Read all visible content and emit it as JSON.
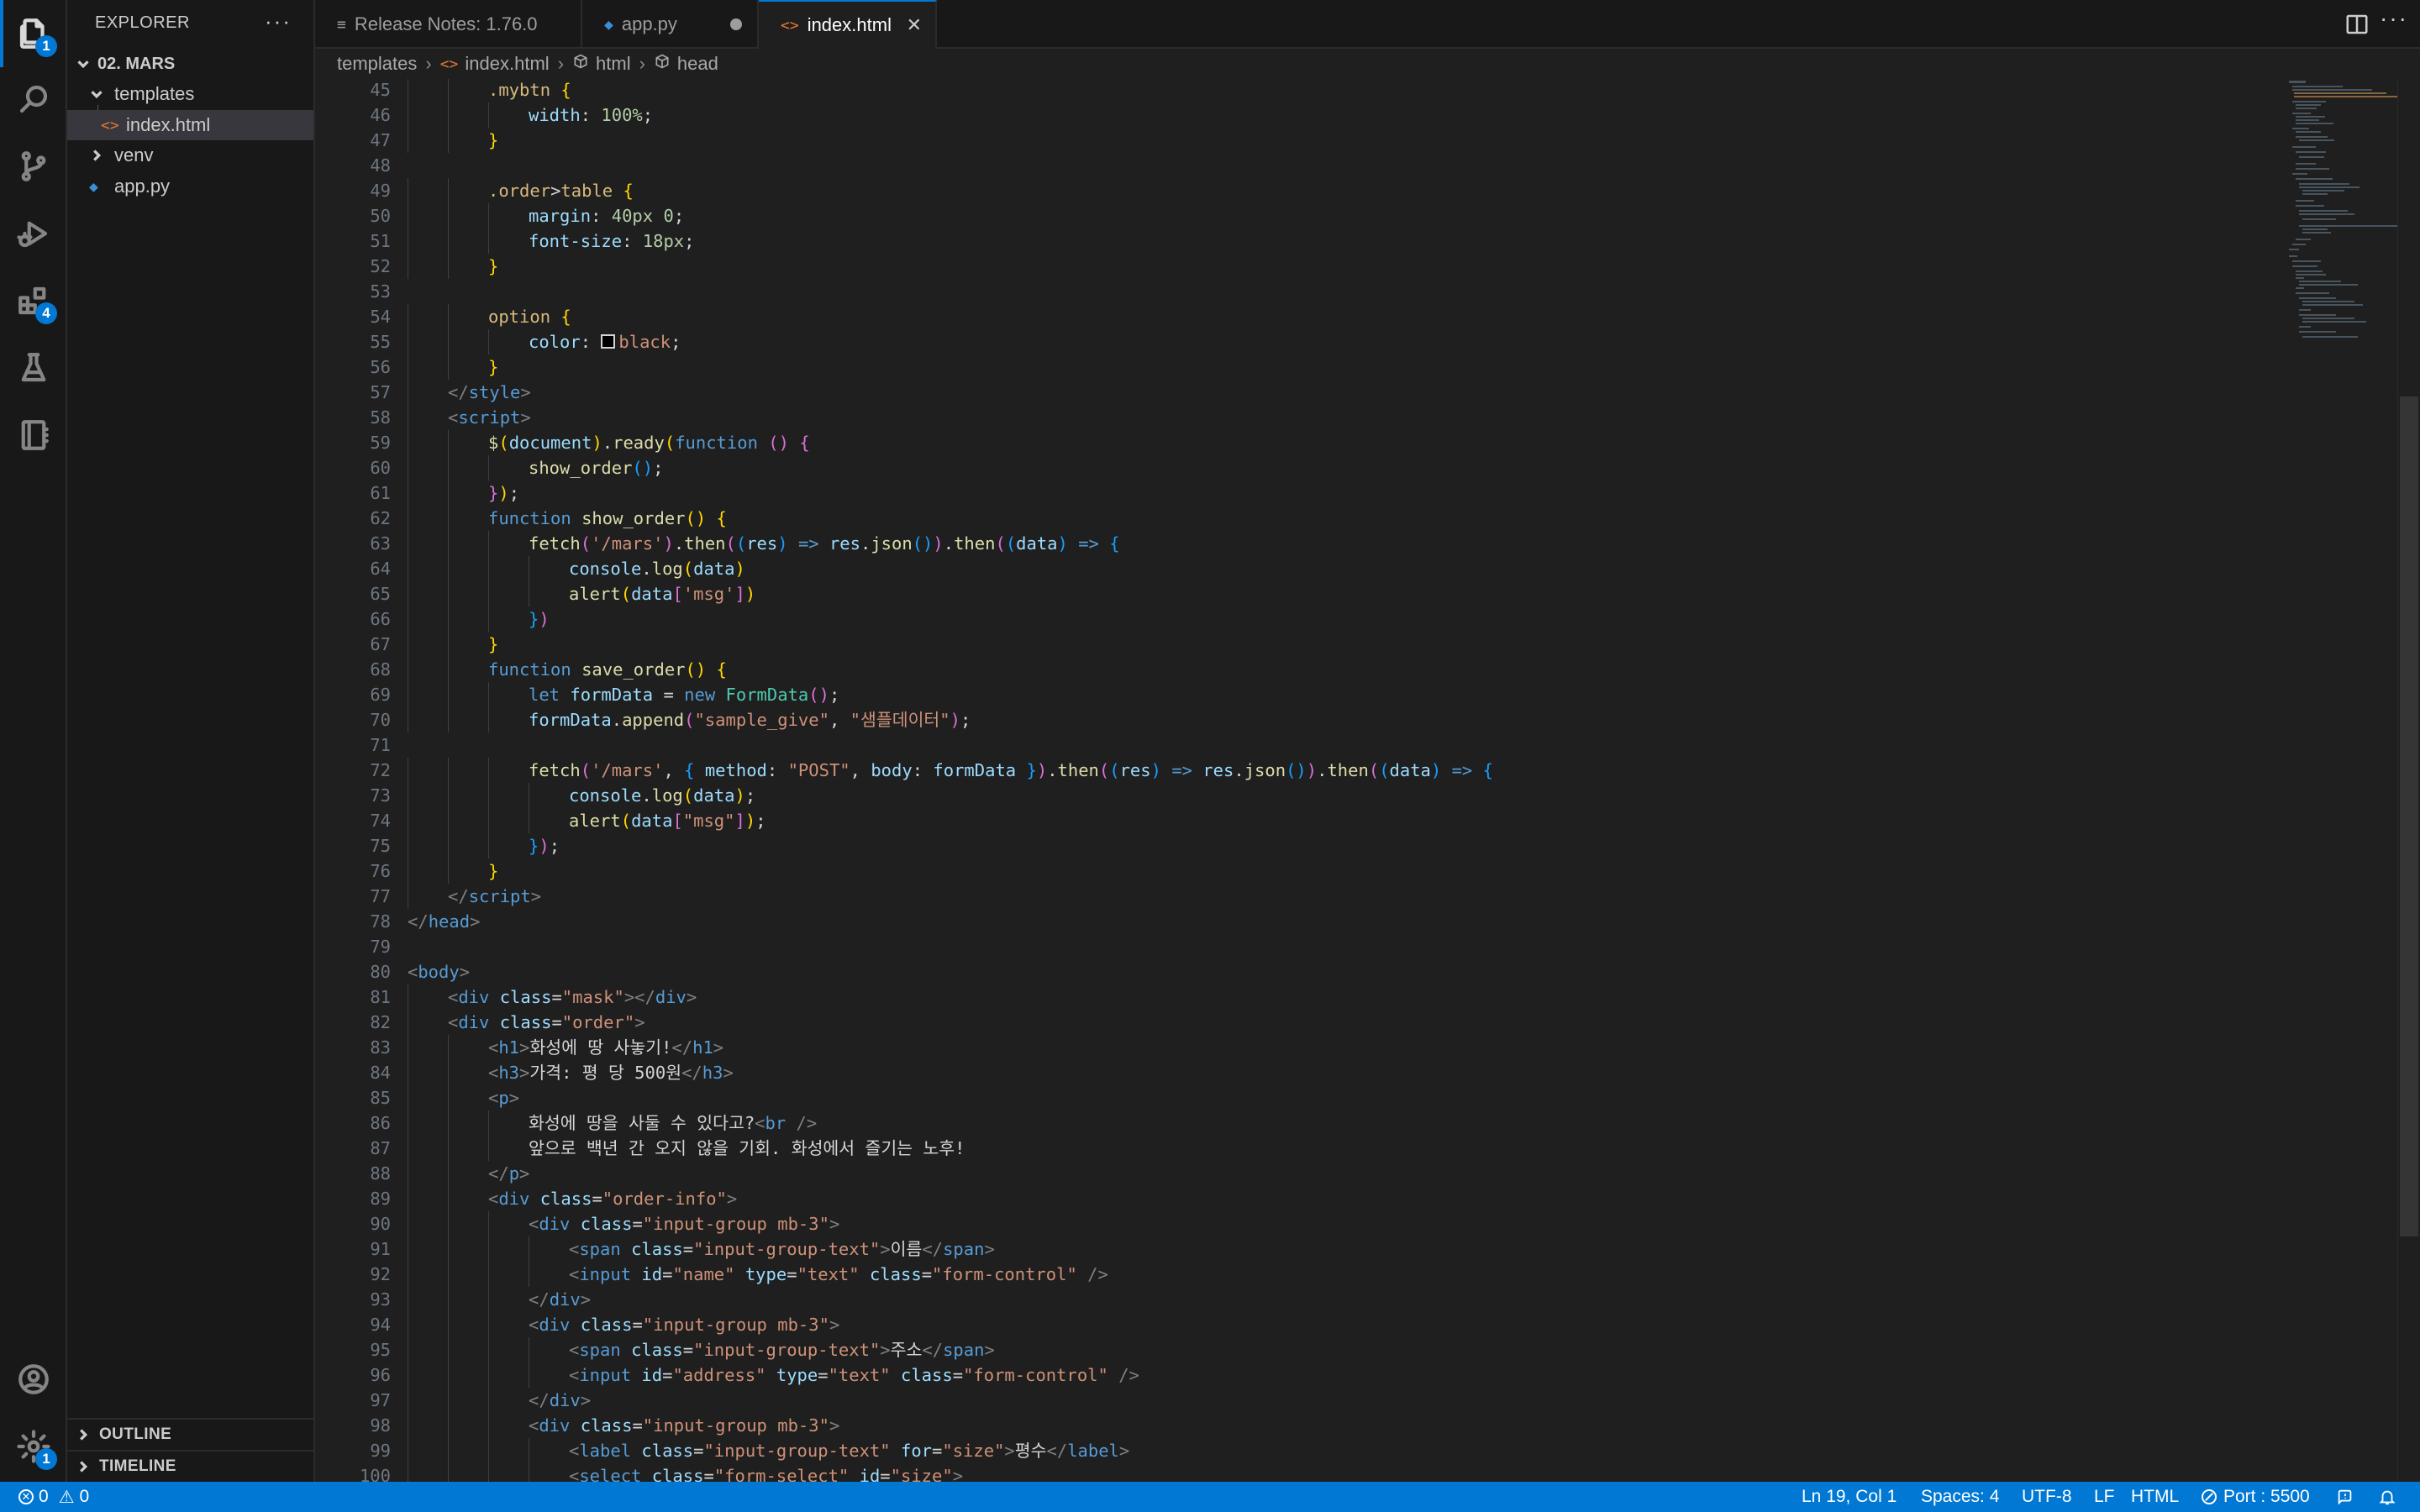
{
  "activity_bar": {
    "explorer_badge": "1",
    "extensions_badge": "4",
    "settings_badge": "1"
  },
  "sidebar": {
    "title": "EXPLORER",
    "more": "···",
    "folder": "02. MARS",
    "tree": [
      {
        "label": "templates"
      },
      {
        "label": "index.html"
      },
      {
        "label": "venv"
      },
      {
        "label": "app.py"
      }
    ],
    "outline": "OUTLINE",
    "timeline": "TIMELINE"
  },
  "tabs": [
    {
      "label": "Release Notes: 1.76.0"
    },
    {
      "label": "app.py"
    },
    {
      "label": "index.html"
    }
  ],
  "breadcrumbs": [
    "templates",
    "index.html",
    "html",
    "head"
  ],
  "editor": {
    "lines": [
      {
        "n": "45",
        "indent": 2,
        "html": "<span class=\"t-sel\">.mybtn</span> <span class=\"t-b1\">{</span>"
      },
      {
        "n": "46",
        "indent": 3,
        "html": "<span class=\"t-prop\">width</span>: <span class=\"t-num\">100%</span>;"
      },
      {
        "n": "47",
        "indent": 2,
        "html": "<span class=\"t-b1\">}</span>"
      },
      {
        "n": "48",
        "indent": 0,
        "html": ""
      },
      {
        "n": "49",
        "indent": 2,
        "html": "<span class=\"t-sel\">.order</span>&gt;<span class=\"t-sel\">table</span> <span class=\"t-b1\">{</span>"
      },
      {
        "n": "50",
        "indent": 3,
        "html": "<span class=\"t-prop\">margin</span>: <span class=\"t-num\">40px</span> <span class=\"t-num\">0</span>;"
      },
      {
        "n": "51",
        "indent": 3,
        "html": "<span class=\"t-prop\">font-size</span>: <span class=\"t-num\">18px</span>;"
      },
      {
        "n": "52",
        "indent": 2,
        "html": "<span class=\"t-b1\">}</span>"
      },
      {
        "n": "53",
        "indent": 0,
        "html": ""
      },
      {
        "n": "54",
        "indent": 2,
        "html": "<span class=\"t-sel\">option</span> <span class=\"t-b1\">{</span>"
      },
      {
        "n": "55",
        "indent": 3,
        "html": "<span class=\"t-prop\">color</span>: <span class=\"swatch\"></span><span class=\"t-str\">black</span>;"
      },
      {
        "n": "56",
        "indent": 2,
        "html": "<span class=\"t-b1\">}</span>"
      },
      {
        "n": "57",
        "indent": 1,
        "html": "<span class=\"t-br\">&lt;/</span><span class=\"t-tag\">style</span><span class=\"t-br\">&gt;</span>"
      },
      {
        "n": "58",
        "indent": 1,
        "html": "<span class=\"t-br\">&lt;</span><span class=\"t-tag\">script</span><span class=\"t-br\">&gt;</span>"
      },
      {
        "n": "59",
        "indent": 2,
        "html": "<span class=\"t-fn\">$</span><span class=\"t-b1\">(</span><span class=\"t-attr\">document</span><span class=\"t-b1\">)</span>.<span class=\"t-fn\">ready</span><span class=\"t-b1\">(</span><span class=\"t-kw\">function</span> <span class=\"t-b2\">()</span> <span class=\"t-b2\">{</span>"
      },
      {
        "n": "60",
        "indent": 3,
        "html": "<span class=\"t-fn\">show_order</span><span class=\"t-b3\">()</span>;"
      },
      {
        "n": "61",
        "indent": 2,
        "html": "<span class=\"t-b2\">}</span><span class=\"t-b1\">)</span>;"
      },
      {
        "n": "62",
        "indent": 2,
        "html": "<span class=\"t-kw\">function</span> <span class=\"t-fn\">show_order</span><span class=\"t-b1\">()</span> <span class=\"t-b1\">{</span>"
      },
      {
        "n": "63",
        "indent": 3,
        "html": "<span class=\"t-fn\">fetch</span><span class=\"t-b2\">(</span><span class=\"t-str\">'/mars'</span><span class=\"t-b2\">)</span>.<span class=\"t-fn\">then</span><span class=\"t-b2\">(</span><span class=\"t-b3\">(</span><span class=\"t-attr\">res</span><span class=\"t-b3\">)</span> <span class=\"t-kw\">=&gt;</span> <span class=\"t-attr\">res</span>.<span class=\"t-fn\">json</span><span class=\"t-b3\">()</span><span class=\"t-b2\">)</span>.<span class=\"t-fn\">then</span><span class=\"t-b2\">(</span><span class=\"t-b3\">(</span><span class=\"t-attr\">data</span><span class=\"t-b3\">)</span> <span class=\"t-kw\">=&gt;</span> <span class=\"t-b3\">{</span>"
      },
      {
        "n": "64",
        "indent": 4,
        "html": "<span class=\"t-attr\">console</span>.<span class=\"t-fn\">log</span><span class=\"t-b1\">(</span><span class=\"t-attr\">data</span><span class=\"t-b1\">)</span>"
      },
      {
        "n": "65",
        "indent": 4,
        "html": "<span class=\"t-fn\">alert</span><span class=\"t-b1\">(</span><span class=\"t-attr\">data</span><span class=\"t-b2\">[</span><span class=\"t-str\">'msg'</span><span class=\"t-b2\">]</span><span class=\"t-b1\">)</span>"
      },
      {
        "n": "66",
        "indent": 3,
        "html": "<span class=\"t-b3\">}</span><span class=\"t-b2\">)</span>"
      },
      {
        "n": "67",
        "indent": 2,
        "html": "<span class=\"t-b1\">}</span>"
      },
      {
        "n": "68",
        "indent": 2,
        "html": "<span class=\"t-kw\">function</span> <span class=\"t-fn\">save_order</span><span class=\"t-b1\">()</span> <span class=\"t-b1\">{</span>"
      },
      {
        "n": "69",
        "indent": 3,
        "html": "<span class=\"t-kw\">let</span> <span class=\"t-attr\">formData</span> = <span class=\"t-kw\">new</span> <span class=\"t-cls\">FormData</span><span class=\"t-b2\">()</span>;"
      },
      {
        "n": "70",
        "indent": 3,
        "html": "<span class=\"t-attr\">formData</span>.<span class=\"t-fn\">append</span><span class=\"t-b2\">(</span><span class=\"t-str\">\"sample_give\"</span>, <span class=\"t-str\">\"샘플데이터\"</span><span class=\"t-b2\">)</span>;"
      },
      {
        "n": "71",
        "indent": 0,
        "html": ""
      },
      {
        "n": "72",
        "indent": 3,
        "html": "<span class=\"t-fn\">fetch</span><span class=\"t-b2\">(</span><span class=\"t-str\">'/mars'</span>, <span class=\"t-b3\">{</span> <span class=\"t-attr\">method</span>: <span class=\"t-str\">\"POST\"</span>, <span class=\"t-attr\">body</span>: <span class=\"t-attr\">formData</span> <span class=\"t-b3\">}</span><span class=\"t-b2\">)</span>.<span class=\"t-fn\">then</span><span class=\"t-b2\">(</span><span class=\"t-b3\">(</span><span class=\"t-attr\">res</span><span class=\"t-b3\">)</span> <span class=\"t-kw\">=&gt;</span> <span class=\"t-attr\">res</span>.<span class=\"t-fn\">json</span><span class=\"t-b3\">()</span><span class=\"t-b2\">)</span>.<span class=\"t-fn\">then</span><span class=\"t-b2\">(</span><span class=\"t-b3\">(</span><span class=\"t-attr\">data</span><span class=\"t-b3\">)</span> <span class=\"t-kw\">=&gt;</span> <span class=\"t-b3\">{</span>"
      },
      {
        "n": "73",
        "indent": 4,
        "html": "<span class=\"t-attr\">console</span>.<span class=\"t-fn\">log</span><span class=\"t-b1\">(</span><span class=\"t-attr\">data</span><span class=\"t-b1\">)</span>;"
      },
      {
        "n": "74",
        "indent": 4,
        "html": "<span class=\"t-fn\">alert</span><span class=\"t-b1\">(</span><span class=\"t-attr\">data</span><span class=\"t-b2\">[</span><span class=\"t-str\">\"msg\"</span><span class=\"t-b2\">]</span><span class=\"t-b1\">)</span>;"
      },
      {
        "n": "75",
        "indent": 3,
        "html": "<span class=\"t-b3\">}</span><span class=\"t-b2\">)</span>;"
      },
      {
        "n": "76",
        "indent": 2,
        "html": "<span class=\"t-b1\">}</span>"
      },
      {
        "n": "77",
        "indent": 1,
        "html": "<span class=\"t-br\">&lt;/</span><span class=\"t-tag\">script</span><span class=\"t-br\">&gt;</span>"
      },
      {
        "n": "78",
        "indent": 0,
        "html": "<span class=\"t-br\">&lt;/</span><span class=\"t-tag\">head</span><span class=\"t-br\">&gt;</span>"
      },
      {
        "n": "79",
        "indent": 0,
        "html": ""
      },
      {
        "n": "80",
        "indent": 0,
        "html": "<span class=\"t-br\">&lt;</span><span class=\"t-tag\">body</span><span class=\"t-br\">&gt;</span>"
      },
      {
        "n": "81",
        "indent": 1,
        "html": "<span class=\"t-br\">&lt;</span><span class=\"t-tag\">div</span> <span class=\"t-attr\">class</span>=<span class=\"t-str\">\"mask\"</span><span class=\"t-br\">&gt;&lt;/</span><span class=\"t-tag\">div</span><span class=\"t-br\">&gt;</span>"
      },
      {
        "n": "82",
        "indent": 1,
        "html": "<span class=\"t-br\">&lt;</span><span class=\"t-tag\">div</span> <span class=\"t-attr\">class</span>=<span class=\"t-str\">\"order\"</span><span class=\"t-br\">&gt;</span>"
      },
      {
        "n": "83",
        "indent": 2,
        "html": "<span class=\"t-br\">&lt;</span><span class=\"t-tag\">h1</span><span class=\"t-br\">&gt;</span>화성에 땅 사놓기!<span class=\"t-br\">&lt;/</span><span class=\"t-tag\">h1</span><span class=\"t-br\">&gt;</span>"
      },
      {
        "n": "84",
        "indent": 2,
        "html": "<span class=\"t-br\">&lt;</span><span class=\"t-tag\">h3</span><span class=\"t-br\">&gt;</span>가격: 평 당 500원<span class=\"t-br\">&lt;/</span><span class=\"t-tag\">h3</span><span class=\"t-br\">&gt;</span>"
      },
      {
        "n": "85",
        "indent": 2,
        "html": "<span class=\"t-br\">&lt;</span><span class=\"t-tag\">p</span><span class=\"t-br\">&gt;</span>"
      },
      {
        "n": "86",
        "indent": 3,
        "html": "화성에 땅을 사둘 수 있다고?<span class=\"t-br\">&lt;</span><span class=\"t-tag\">br</span> <span class=\"t-br\">/&gt;</span>"
      },
      {
        "n": "87",
        "indent": 3,
        "html": "앞으로 백년 간 오지 않을 기회. 화성에서 즐기는 노후!"
      },
      {
        "n": "88",
        "indent": 2,
        "html": "<span class=\"t-br\">&lt;/</span><span class=\"t-tag\">p</span><span class=\"t-br\">&gt;</span>"
      },
      {
        "n": "89",
        "indent": 2,
        "html": "<span class=\"t-br\">&lt;</span><span class=\"t-tag\">div</span> <span class=\"t-attr\">class</span>=<span class=\"t-str\">\"order-info\"</span><span class=\"t-br\">&gt;</span>"
      },
      {
        "n": "90",
        "indent": 3,
        "html": "<span class=\"t-br\">&lt;</span><span class=\"t-tag\">div</span> <span class=\"t-attr\">class</span>=<span class=\"t-str\">\"input-group mb-3\"</span><span class=\"t-br\">&gt;</span>"
      },
      {
        "n": "91",
        "indent": 4,
        "html": "<span class=\"t-br\">&lt;</span><span class=\"t-tag\">span</span> <span class=\"t-attr\">class</span>=<span class=\"t-str\">\"input-group-text\"</span><span class=\"t-br\">&gt;</span>이름<span class=\"t-br\">&lt;/</span><span class=\"t-tag\">span</span><span class=\"t-br\">&gt;</span>"
      },
      {
        "n": "92",
        "indent": 4,
        "html": "<span class=\"t-br\">&lt;</span><span class=\"t-tag\">input</span> <span class=\"t-attr\">id</span>=<span class=\"t-str\">\"name\"</span> <span class=\"t-attr\">type</span>=<span class=\"t-str\">\"text\"</span> <span class=\"t-attr\">class</span>=<span class=\"t-str\">\"form-control\"</span> <span class=\"t-br\">/&gt;</span>"
      },
      {
        "n": "93",
        "indent": 3,
        "html": "<span class=\"t-br\">&lt;/</span><span class=\"t-tag\">div</span><span class=\"t-br\">&gt;</span>"
      },
      {
        "n": "94",
        "indent": 3,
        "html": "<span class=\"t-br\">&lt;</span><span class=\"t-tag\">div</span> <span class=\"t-attr\">class</span>=<span class=\"t-str\">\"input-group mb-3\"</span><span class=\"t-br\">&gt;</span>"
      },
      {
        "n": "95",
        "indent": 4,
        "html": "<span class=\"t-br\">&lt;</span><span class=\"t-tag\">span</span> <span class=\"t-attr\">class</span>=<span class=\"t-str\">\"input-group-text\"</span><span class=\"t-br\">&gt;</span>주소<span class=\"t-br\">&lt;/</span><span class=\"t-tag\">span</span><span class=\"t-br\">&gt;</span>"
      },
      {
        "n": "96",
        "indent": 4,
        "html": "<span class=\"t-br\">&lt;</span><span class=\"t-tag\">input</span> <span class=\"t-attr\">id</span>=<span class=\"t-str\">\"address\"</span> <span class=\"t-attr\">type</span>=<span class=\"t-str\">\"text\"</span> <span class=\"t-attr\">class</span>=<span class=\"t-str\">\"form-control\"</span> <span class=\"t-br\">/&gt;</span>"
      },
      {
        "n": "97",
        "indent": 3,
        "html": "<span class=\"t-br\">&lt;/</span><span class=\"t-tag\">div</span><span class=\"t-br\">&gt;</span>"
      },
      {
        "n": "98",
        "indent": 3,
        "html": "<span class=\"t-br\">&lt;</span><span class=\"t-tag\">div</span> <span class=\"t-attr\">class</span>=<span class=\"t-str\">\"input-group mb-3\"</span><span class=\"t-br\">&gt;</span>"
      },
      {
        "n": "99",
        "indent": 4,
        "html": "<span class=\"t-br\">&lt;</span><span class=\"t-tag\">label</span> <span class=\"t-attr\">class</span>=<span class=\"t-str\">\"input-group-text\"</span> <span class=\"t-attr\">for</span>=<span class=\"t-str\">\"size\"</span><span class=\"t-br\">&gt;</span>평수<span class=\"t-br\">&lt;/</span><span class=\"t-tag\">label</span><span class=\"t-br\">&gt;</span>"
      },
      {
        "n": "100",
        "indent": 4,
        "html": "<span class=\"t-br\">&lt;</span><span class=\"t-tag\">select</span> <span class=\"t-attr\">class</span>=<span class=\"t-str\">\"form-select\"</span> <span class=\"t-attr\">id</span>=<span class=\"t-str\">\"size\"</span><span class=\"t-br\">&gt;</span>"
      }
    ]
  },
  "status_bar": {
    "errors": "0",
    "warnings": "0",
    "position": "Ln 19, Col 1",
    "spaces": "Spaces: 4",
    "encoding": "UTF-8",
    "eol": "LF",
    "language": "HTML",
    "port": "Port : 5500"
  },
  "colors": {
    "accent": "#0078d4",
    "editor_bg": "#1f1f1f",
    "sidebar_bg": "#181818"
  }
}
